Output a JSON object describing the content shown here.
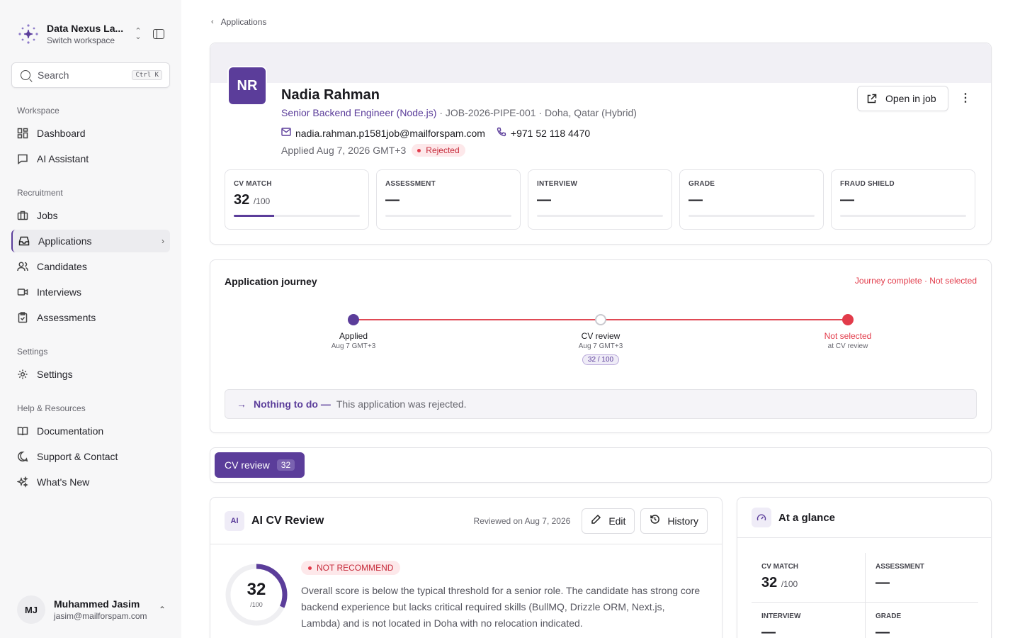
{
  "workspace": {
    "name": "Data Nexus La...",
    "sub": "Switch workspace"
  },
  "search": {
    "placeholder": "Search",
    "shortcut": "Ctrl K"
  },
  "nav": {
    "workspace_label": "Workspace",
    "dashboard": "Dashboard",
    "ai_assistant": "AI Assistant",
    "recruitment_label": "Recruitment",
    "jobs": "Jobs",
    "applications": "Applications",
    "candidates": "Candidates",
    "interviews": "Interviews",
    "assessments": "Assessments",
    "settings_label": "Settings",
    "settings": "Settings",
    "help_label": "Help & Resources",
    "documentation": "Documentation",
    "support": "Support & Contact",
    "whats_new": "What's New"
  },
  "user": {
    "initials": "MJ",
    "name": "Muhammed Jasim",
    "email": "jasim@mailforspam.com"
  },
  "breadcrumb": "Applications",
  "candidate": {
    "initials": "NR",
    "name": "Nadia Rahman",
    "role": "Senior Backend Engineer (Node.js)",
    "job_meta": "· JOB-2026-PIPE-001 · Doha, Qatar (Hybrid)",
    "email": "nadia.rahman.p1581job@mailforspam.com",
    "phone": "+971 52 118 4470",
    "applied": "Applied Aug 7, 2026 GMT+3",
    "status": "Rejected",
    "open_job": "Open in job"
  },
  "metrics": [
    {
      "label": "CV MATCH",
      "value": "32",
      "suffix": "/100",
      "progress": 0.32
    },
    {
      "label": "ASSESSMENT",
      "value": "—",
      "suffix": "",
      "progress": 0
    },
    {
      "label": "INTERVIEW",
      "value": "—",
      "suffix": "",
      "progress": 0
    },
    {
      "label": "GRADE",
      "value": "—",
      "suffix": "",
      "progress": 0
    },
    {
      "label": "FRAUD SHIELD",
      "value": "—",
      "suffix": "",
      "progress": 0
    }
  ],
  "journey": {
    "title": "Application journey",
    "status": "Journey complete · Not selected",
    "steps": [
      {
        "label": "Applied",
        "date": "Aug 7 GMT+3",
        "chip": ""
      },
      {
        "label": "CV review",
        "date": "Aug 7 GMT+3",
        "chip": "32 / 100"
      },
      {
        "label": "Not selected",
        "date": "at CV review",
        "chip": ""
      }
    ],
    "todo_title": "Nothing to do —",
    "todo_text": "This application was rejected."
  },
  "tabs": [
    {
      "label": "CV review",
      "count": "32"
    }
  ],
  "review": {
    "badge": "AI",
    "title": "AI CV Review",
    "reviewed": "Reviewed on Aug 7, 2026",
    "edit": "Edit",
    "history": "History",
    "score": "32",
    "score_den": "/100",
    "score_fraction": 0.32,
    "recommendation": "NOT RECOMMEND",
    "summary": "Overall score is below the typical threshold for a senior role. The candidate has strong core backend experience but lacks critical required skills (BullMQ, Drizzle ORM, Next.js, Lambda) and is not located in Doha with no relocation indicated."
  },
  "glance": {
    "title": "At a glance",
    "cells": [
      {
        "label": "CV MATCH",
        "value": "32",
        "suffix": "/100"
      },
      {
        "label": "ASSESSMENT",
        "value": "—",
        "suffix": ""
      },
      {
        "label": "INTERVIEW",
        "value": "—",
        "suffix": ""
      },
      {
        "label": "GRADE",
        "value": "—",
        "suffix": ""
      }
    ]
  },
  "colors": {
    "brand": "#5b3d9a",
    "danger": "#e23b4a"
  }
}
